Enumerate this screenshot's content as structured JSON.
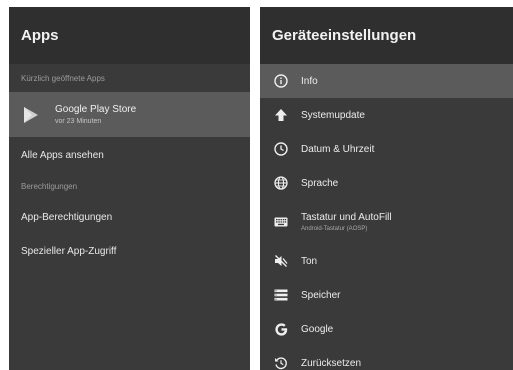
{
  "apps_panel": {
    "title": "Apps",
    "recent_section": "Kürzlich geöffnete Apps",
    "recent_app": {
      "name": "Google Play Store",
      "subtitle": "vor 23 Minuten",
      "icon": "play-store-icon"
    },
    "see_all": "Alle Apps ansehen",
    "permissions_section": "Berechtigungen",
    "app_permissions": "App-Berechtigungen",
    "special_access": "Spezieller App-Zugriff"
  },
  "settings_panel": {
    "title": "Geräteeinstellungen",
    "items": [
      {
        "label": "Info",
        "icon": "info-icon",
        "selected": true
      },
      {
        "label": "Systemupdate",
        "icon": "arrow-up-icon"
      },
      {
        "label": "Datum & Uhrzeit",
        "icon": "clock-icon"
      },
      {
        "label": "Sprache",
        "icon": "globe-icon"
      },
      {
        "label": "Tastatur und AutoFill",
        "subtitle": "Android-Tastatur (AOSP)",
        "icon": "keyboard-icon"
      },
      {
        "label": "Ton",
        "icon": "volume-muted-icon"
      },
      {
        "label": "Speicher",
        "icon": "storage-icon"
      },
      {
        "label": "Google",
        "icon": "google-icon"
      },
      {
        "label": "Zurücksetzen",
        "icon": "reset-icon"
      }
    ]
  },
  "colors": {
    "panel": "#3a3a3a",
    "header": "#2f2f2f",
    "selected": "#5b5b5b"
  }
}
